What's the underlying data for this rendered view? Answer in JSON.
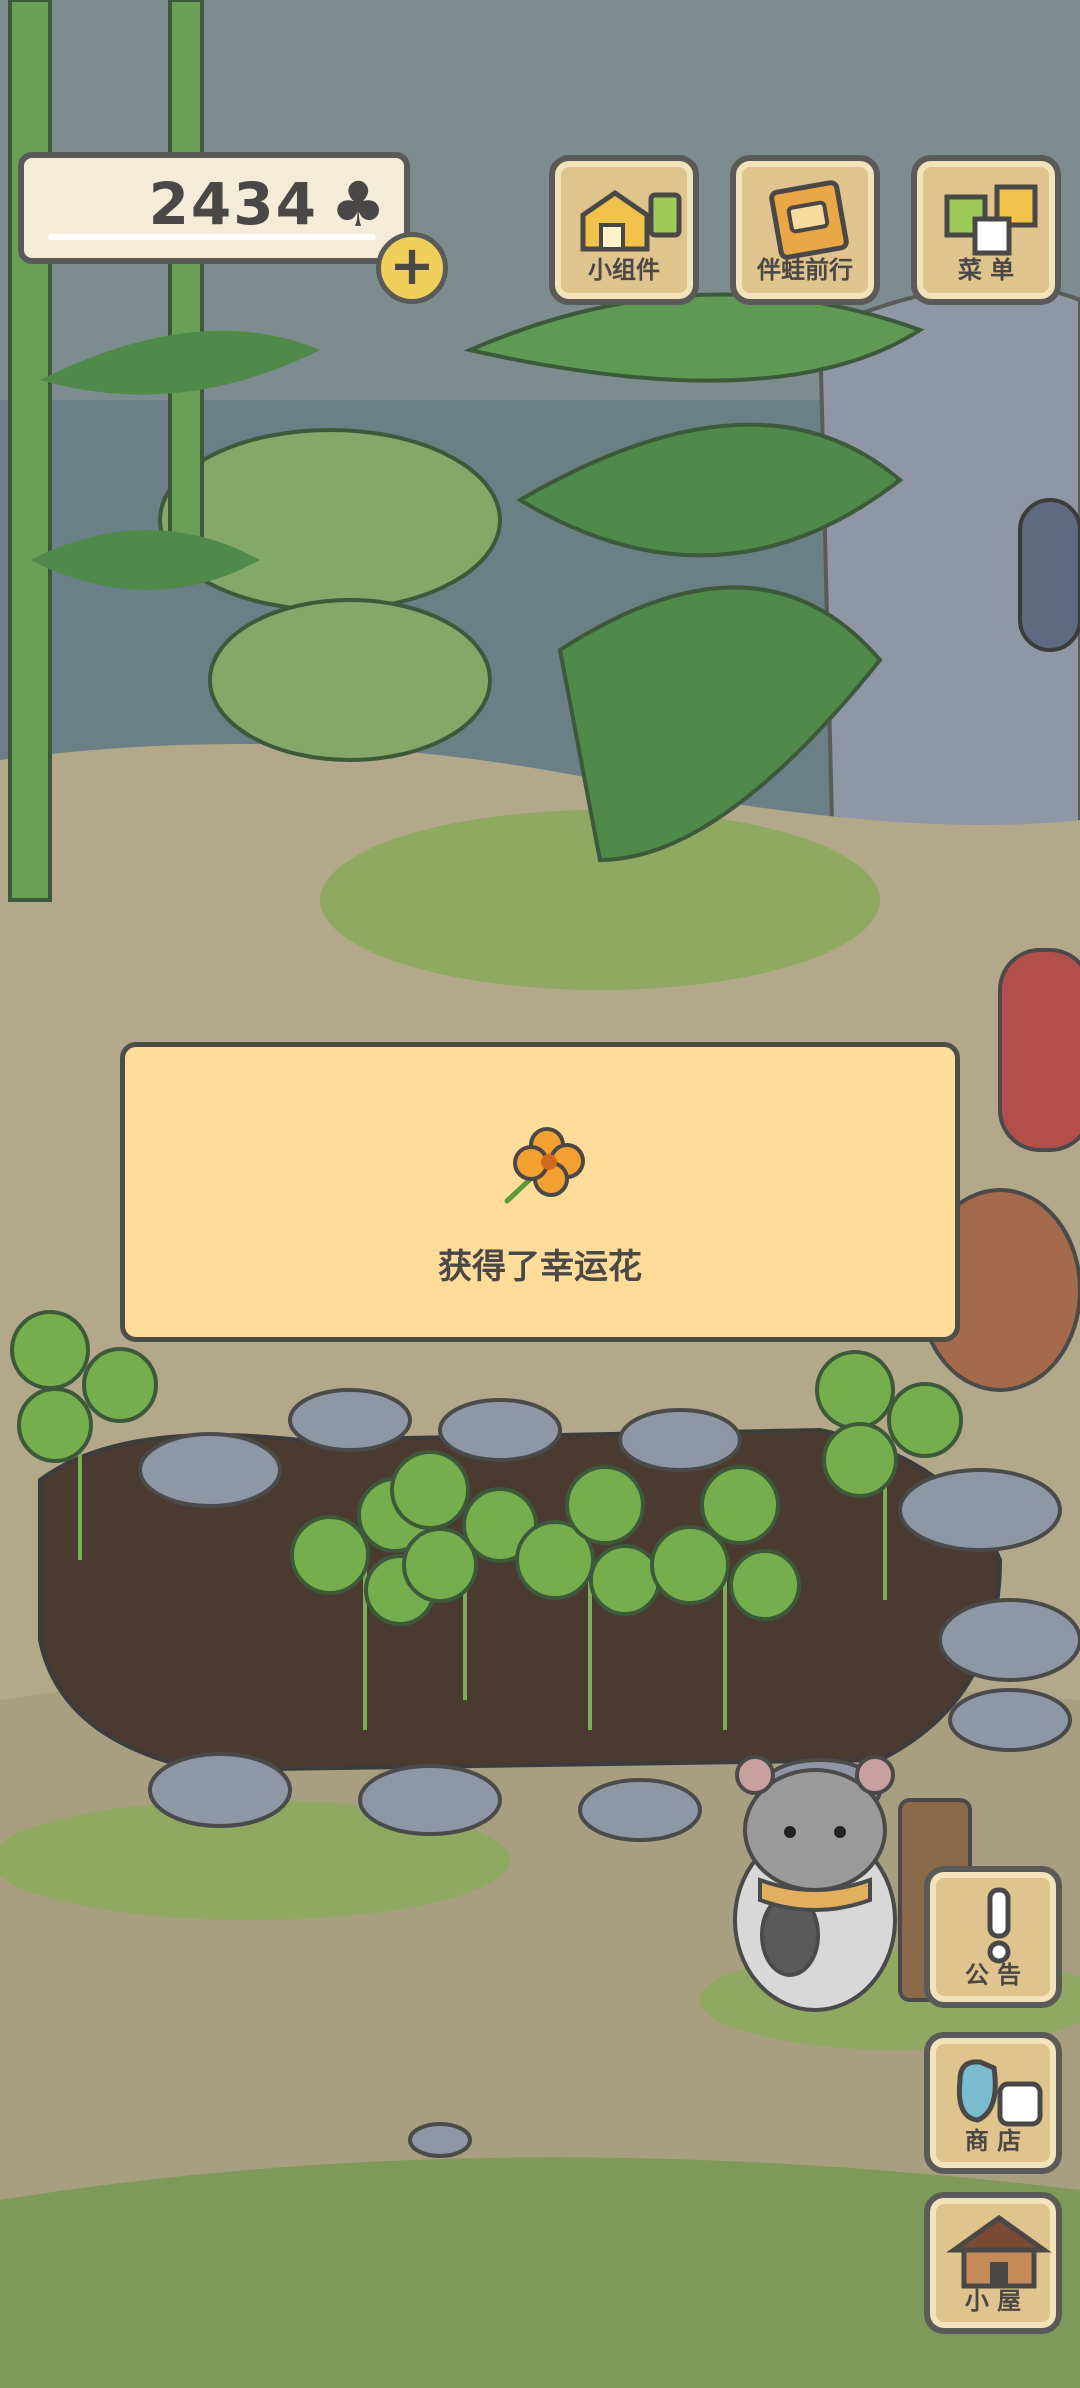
{
  "hud": {
    "clover_count": "2434",
    "clover_symbol": "♣",
    "plus_symbol": "+"
  },
  "top_menu": [
    {
      "label": "小组件",
      "icon": "widget-icon"
    },
    {
      "label": "伴蛙前行",
      "icon": "journey-book-icon"
    },
    {
      "label": "菜 单",
      "icon": "menu-icon"
    }
  ],
  "dialog": {
    "message": "获得了幸运花",
    "icon": "lucky-flower-icon"
  },
  "side_menu": [
    {
      "label": "公 告",
      "icon": "notice-icon"
    },
    {
      "label": "商 店",
      "icon": "shop-icon"
    },
    {
      "label": "小 屋",
      "icon": "house-icon"
    }
  ],
  "colors": {
    "panel": "#ffdc9a",
    "wood": "#e0c48e",
    "outline": "#5a5a58",
    "text": "#4a4846"
  }
}
